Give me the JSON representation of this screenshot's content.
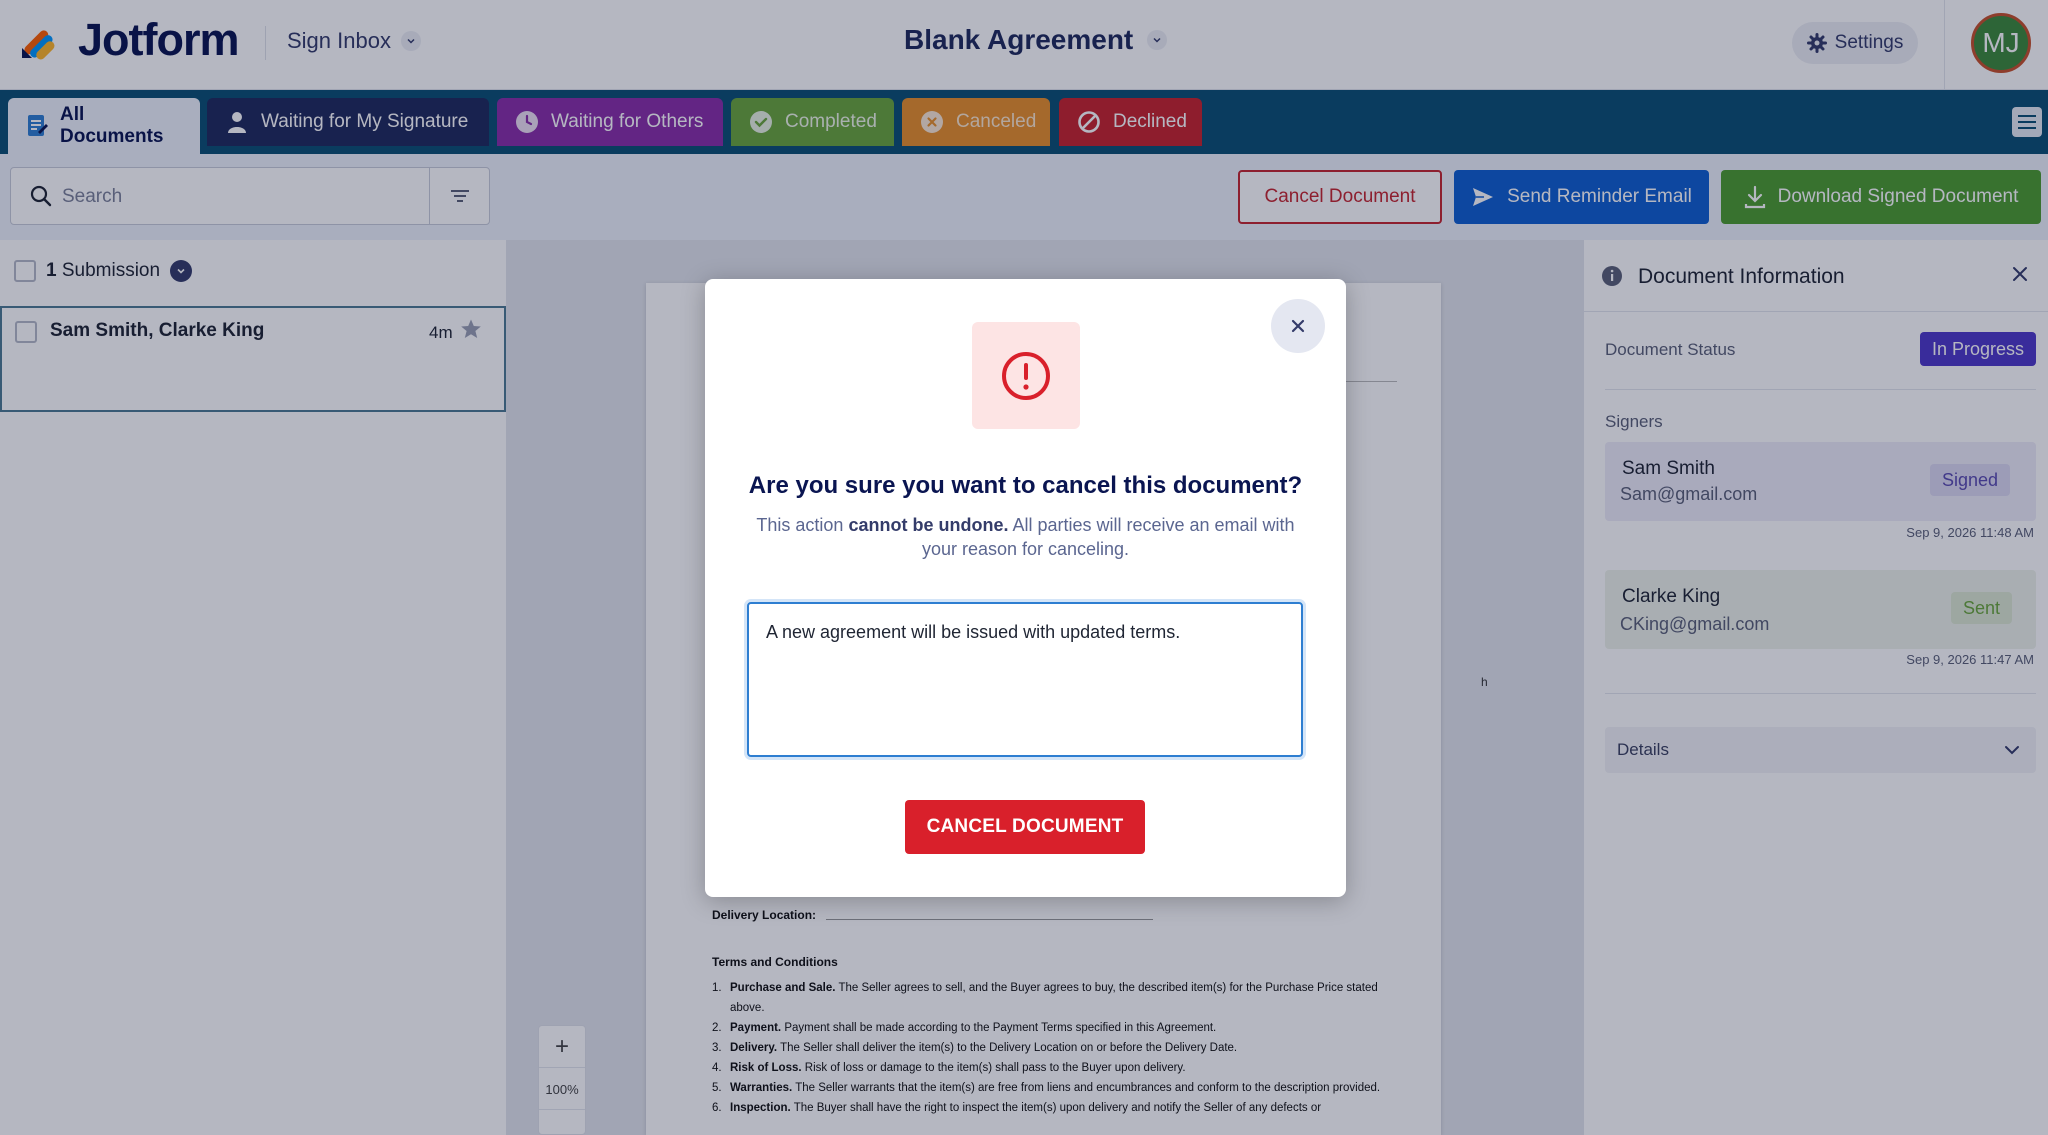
{
  "header": {
    "brand": "Jotform",
    "inbox_label": "Sign Inbox",
    "document_title": "Blank Agreement",
    "settings_label": "Settings",
    "avatar_initials": "MJ"
  },
  "tabs": [
    {
      "label": "All Documents",
      "color": "#eef2fb"
    },
    {
      "label": "Waiting for My Signature",
      "color": "#1f2a5c"
    },
    {
      "label": "Waiting for Others",
      "color": "#8a2fa8"
    },
    {
      "label": "Completed",
      "color": "#6aa63b"
    },
    {
      "label": "Canceled",
      "color": "#e8902a"
    },
    {
      "label": "Declined",
      "color": "#c8232c"
    }
  ],
  "toolbar": {
    "search_placeholder": "Search",
    "cancel_document": "Cancel Document",
    "send_reminder": "Send Reminder Email",
    "download_signed": "Download Signed Document"
  },
  "list": {
    "count": "1",
    "count_label": "Submission",
    "items": [
      {
        "name": "Sam Smith, Clarke King",
        "time": "4m"
      }
    ]
  },
  "document": {
    "fragment": "h",
    "delivery_label": "Delivery Location:",
    "terms_heading": "Terms and Conditions",
    "terms": [
      {
        "num": "1.",
        "title": "Purchase and Sale.",
        "text": "The Seller agrees to sell, and the Buyer agrees to buy, the described item(s) for the Purchase Price stated above."
      },
      {
        "num": "2.",
        "title": "Payment.",
        "text": "Payment shall be made according to the Payment Terms specified in this Agreement."
      },
      {
        "num": "3.",
        "title": "Delivery.",
        "text": "The Seller shall deliver the item(s) to the Delivery Location on or before the Delivery Date."
      },
      {
        "num": "4.",
        "title": "Risk of Loss.",
        "text": "Risk of loss or damage to the item(s) shall pass to the Buyer upon delivery."
      },
      {
        "num": "5.",
        "title": "Warranties.",
        "text": "The Seller warrants that the item(s) are free from liens and encumbrances and conform to the description provided."
      },
      {
        "num": "6.",
        "title": "Inspection.",
        "text": "The Buyer shall have the right to inspect the item(s) upon delivery and notify the Seller of any defects or"
      }
    ],
    "zoom": "100%"
  },
  "info_panel": {
    "title": "Document Information",
    "status_label": "Document Status",
    "status_value": "In Progress",
    "signers_label": "Signers",
    "signers": [
      {
        "name": "Sam Smith",
        "email": "Sam@gmail.com",
        "status": "Signed",
        "date": "Sep 9, 2026 11:48 AM"
      },
      {
        "name": "Clarke King",
        "email": "CKing@gmail.com",
        "status": "Sent",
        "date": "Sep 9, 2026 11:47 AM"
      }
    ],
    "details_label": "Details"
  },
  "modal": {
    "title": "Are you sure you want to cancel this document?",
    "desc_prefix": "This action ",
    "desc_bold": "cannot be undone.",
    "desc_suffix": " All parties will receive an email with your reason for canceling.",
    "reason_value": "A new agreement will be issued with updated terms.",
    "confirm_label": "CANCEL DOCUMENT"
  }
}
